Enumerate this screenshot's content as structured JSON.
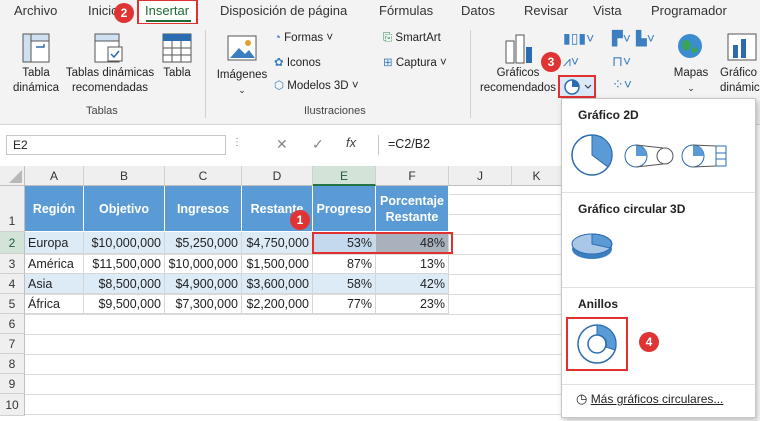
{
  "tabs": [
    "Archivo",
    "Inicio",
    "Insertar",
    "Disposición de página",
    "Fórmulas",
    "Datos",
    "Revisar",
    "Vista",
    "Programador"
  ],
  "ribbon": {
    "tables_group": {
      "label": "Tablas",
      "pivot_table": [
        "Tabla",
        "dinámica"
      ],
      "recommended_pivot": [
        "Tablas dinámicas",
        "recomendadas"
      ],
      "table": "Tabla"
    },
    "illustrations_group": {
      "label": "Ilustraciones",
      "images": "Imágenes",
      "shapes": "Formas",
      "icons": "Iconos",
      "models3d": "Modelos 3D",
      "smartart": "SmartArt",
      "screenshot": "Captura"
    },
    "charts_group": {
      "recommended_charts": [
        "Gráficos",
        "recomendados"
      ],
      "maps": "Mapas",
      "pivot_chart": [
        "Gráfico",
        "dinámico"
      ]
    }
  },
  "badges": [
    "1",
    "2",
    "3",
    "4"
  ],
  "formula_bar": {
    "name_box": "E2",
    "fx": "fx",
    "formula": "=C2/B2"
  },
  "columns": [
    "A",
    "B",
    "C",
    "D",
    "E",
    "F",
    "J",
    "K"
  ],
  "rows": [
    "1",
    "2",
    "3",
    "4",
    "5",
    "6",
    "7",
    "8",
    "9",
    "10"
  ],
  "table": {
    "headers": [
      "Región",
      "Objetivo",
      "Ingresos",
      "Restante",
      "Progreso",
      "Porcentaje Restante"
    ],
    "data": [
      [
        "Europa",
        "$10,000,000",
        "$5,250,000",
        "$4,750,000",
        "53%",
        "48%"
      ],
      [
        "América",
        "$11,500,000",
        "$10,000,000",
        "$1,500,000",
        "87%",
        "13%"
      ],
      [
        "Asia",
        "$8,500,000",
        "$4,900,000",
        "$3,600,000",
        "58%",
        "42%"
      ],
      [
        "África",
        "$9,500,000",
        "$7,300,000",
        "$2,200,000",
        "77%",
        "23%"
      ]
    ]
  },
  "dropdown": {
    "section_2d": "Gráfico 2D",
    "section_3d": "Gráfico circular 3D",
    "section_donut": "Anillos",
    "more": "Más gráficos circulares..."
  },
  "colors": {
    "accent": "#217346",
    "header_fill": "#5b9bd5",
    "band_fill": "#ddebf7",
    "badge": "#e03434",
    "highlight": "#e03030"
  }
}
